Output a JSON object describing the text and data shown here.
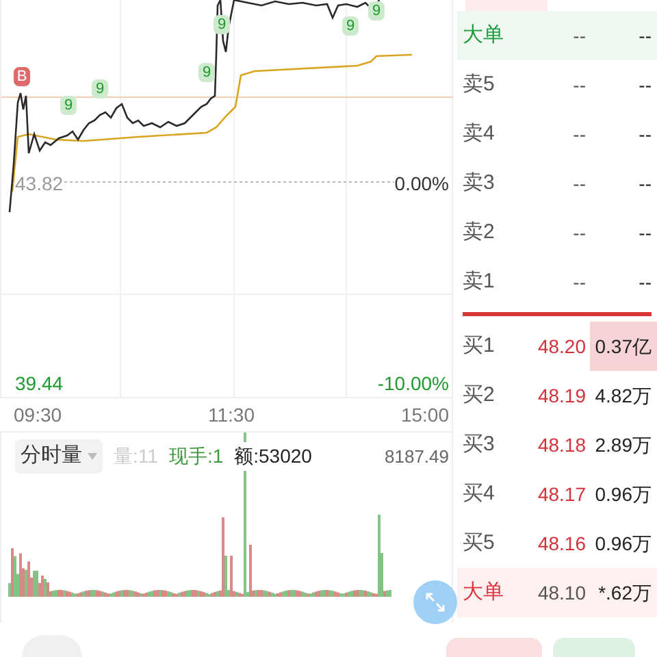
{
  "price_chart": {
    "prev_close": "43.82",
    "prev_change": "0.00%",
    "low": "39.44",
    "low_change": "-10.00%",
    "markers": [
      {
        "label": "B",
        "kind": "buy"
      },
      {
        "label": "9",
        "kind": "nine"
      },
      {
        "label": "9",
        "kind": "nine"
      },
      {
        "label": "9",
        "kind": "nine"
      },
      {
        "label": "9",
        "kind": "nine"
      },
      {
        "label": "9",
        "kind": "nine"
      },
      {
        "label": "9",
        "kind": "nine"
      }
    ]
  },
  "time_axis": [
    "09:30",
    "11:30",
    "15:00"
  ],
  "volume_panel": {
    "selector": "分时量",
    "volume": "量:11",
    "current_hand": "现手:1",
    "amount": "额:53020",
    "max": "8187.49"
  },
  "order_book": {
    "sell_big": {
      "label": "大单",
      "price": "--",
      "volume": "--"
    },
    "asks": [
      {
        "label": "卖5",
        "price": "--",
        "volume": "--"
      },
      {
        "label": "卖4",
        "price": "--",
        "volume": "--"
      },
      {
        "label": "卖3",
        "price": "--",
        "volume": "--"
      },
      {
        "label": "卖2",
        "price": "--",
        "volume": "--"
      },
      {
        "label": "卖1",
        "price": "--",
        "volume": "--"
      }
    ],
    "bids": [
      {
        "label": "买1",
        "price": "48.20",
        "volume": "0.37亿",
        "highlighted": true
      },
      {
        "label": "买2",
        "price": "48.19",
        "volume": "4.82万",
        "highlighted": false
      },
      {
        "label": "买3",
        "price": "48.18",
        "volume": "2.89万",
        "highlighted": false
      },
      {
        "label": "买4",
        "price": "48.17",
        "volume": "0.96万",
        "highlighted": false
      },
      {
        "label": "买5",
        "price": "48.16",
        "volume": "0.96万",
        "highlighted": false
      }
    ],
    "buy_big": {
      "label": "大单",
      "price": "48.10",
      "volume": "*.62万"
    }
  }
}
